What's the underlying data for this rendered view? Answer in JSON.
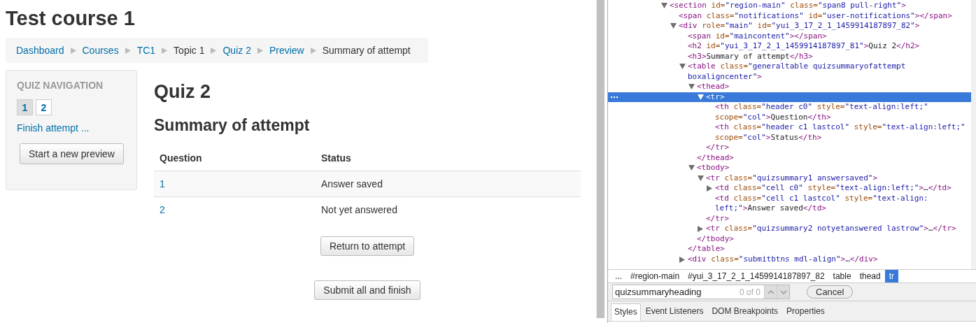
{
  "page": {
    "course_title": "Test course 1",
    "breadcrumbs": [
      {
        "label": "Dashboard",
        "link": true
      },
      {
        "label": "Courses",
        "link": true
      },
      {
        "label": "TC1",
        "link": true
      },
      {
        "label": "Topic 1",
        "link": false
      },
      {
        "label": "Quiz 2",
        "link": true
      },
      {
        "label": "Preview",
        "link": true
      },
      {
        "label": "Summary of attempt",
        "link": false
      }
    ]
  },
  "quiz_navigation": {
    "title": "QUIZ NAVIGATION",
    "questions": [
      {
        "label": "1",
        "answered": true
      },
      {
        "label": "2",
        "answered": false
      }
    ],
    "finish_link": "Finish attempt ...",
    "preview_button": "Start a new preview"
  },
  "main": {
    "heading": "Quiz 2",
    "subheading": "Summary of attempt",
    "table": {
      "columns": [
        "Question",
        "Status"
      ],
      "rows": [
        {
          "question": "1",
          "status": "Answer saved"
        },
        {
          "question": "2",
          "status": "Not yet answered"
        }
      ]
    },
    "buttons": [
      "Return to attempt",
      "Submit all and finish"
    ]
  },
  "devtools": {
    "dom_tree": [
      {
        "markup": "<section id=\"region-main\" class=\"span8 pull-right\">",
        "expanded": true,
        "selected": false,
        "children": [
          {
            "markup": "<span class=\"notifications\" id=\"user-notifications\"></span>",
            "selected": false
          },
          {
            "markup": "<div role=\"main\" id=\"yui_3_17_2_1_1459914187897_82\">",
            "expanded": true,
            "selected": false,
            "children": [
              {
                "markup": "<span id=\"maincontent\"></span>",
                "selected": false
              },
              {
                "markup": "<h2 id=\"yui_3_17_2_1_1459914187897_81\">Quiz 2</h2>",
                "selected": false
              },
              {
                "markup": "<h3>Summary of attempt</h3>",
                "selected": false
              },
              {
                "markup": "<table class=\"generaltable quizsummaryofattempt boxaligncenter\">",
                "expanded": true,
                "selected": false,
                "close": "</table>",
                "children": [
                  {
                    "markup": "<thead>",
                    "expanded": true,
                    "selected": false,
                    "close": "</thead>",
                    "children": [
                      {
                        "markup": "<tr>",
                        "expanded": true,
                        "selected": true,
                        "close": "</tr>",
                        "children": [
                          {
                            "markup": "<th class=\"header c0\" style=\"text-align:left;\" scope=\"col\">Question</th>",
                            "selected": false
                          },
                          {
                            "markup": "<th class=\"header c1 lastcol\" style=\"text-align:left;\" scope=\"col\">Status</th>",
                            "selected": false
                          }
                        ]
                      }
                    ]
                  },
                  {
                    "markup": "<tbody>",
                    "expanded": true,
                    "selected": false,
                    "close": "</tbody>",
                    "children": [
                      {
                        "markup": "<tr class=\"quizsummary1 answersaved\">",
                        "expanded": true,
                        "selected": false,
                        "close": "</tr>",
                        "children": [
                          {
                            "markup": "<td class=\"cell c0\" style=\"text-align:left;\">…</td>",
                            "expanded": false,
                            "selected": false
                          },
                          {
                            "markup": "<td class=\"cell c1 lastcol\" style=\"text-align: left;\">Answer saved</td>",
                            "selected": false
                          }
                        ]
                      },
                      {
                        "markup": "<tr class=\"quizsummary2 notyetanswered lastrow\">…</tr>",
                        "expanded": false,
                        "selected": false
                      }
                    ]
                  }
                ]
              },
              {
                "markup": "<div class=\"submitbtns mdl-align\">…</div>",
                "expanded": false,
                "selected": false
              }
            ]
          }
        ]
      }
    ],
    "path": [
      {
        "label": "...",
        "selected": false
      },
      {
        "label": "#region-main",
        "selected": false
      },
      {
        "label": "#yui_3_17_2_1_1459914187897_82",
        "selected": false
      },
      {
        "label": "table",
        "selected": false
      },
      {
        "label": "thead",
        "selected": false
      },
      {
        "label": "tr",
        "selected": true
      }
    ],
    "search": {
      "value": "quizsummaryheading",
      "count": "0 of 0",
      "cancel": "Cancel"
    },
    "tabs": [
      {
        "label": "Styles",
        "selected": true
      },
      {
        "label": "Event Listeners",
        "selected": false
      },
      {
        "label": "DOM Breakpoints",
        "selected": false
      },
      {
        "label": "Properties",
        "selected": false
      }
    ]
  }
}
